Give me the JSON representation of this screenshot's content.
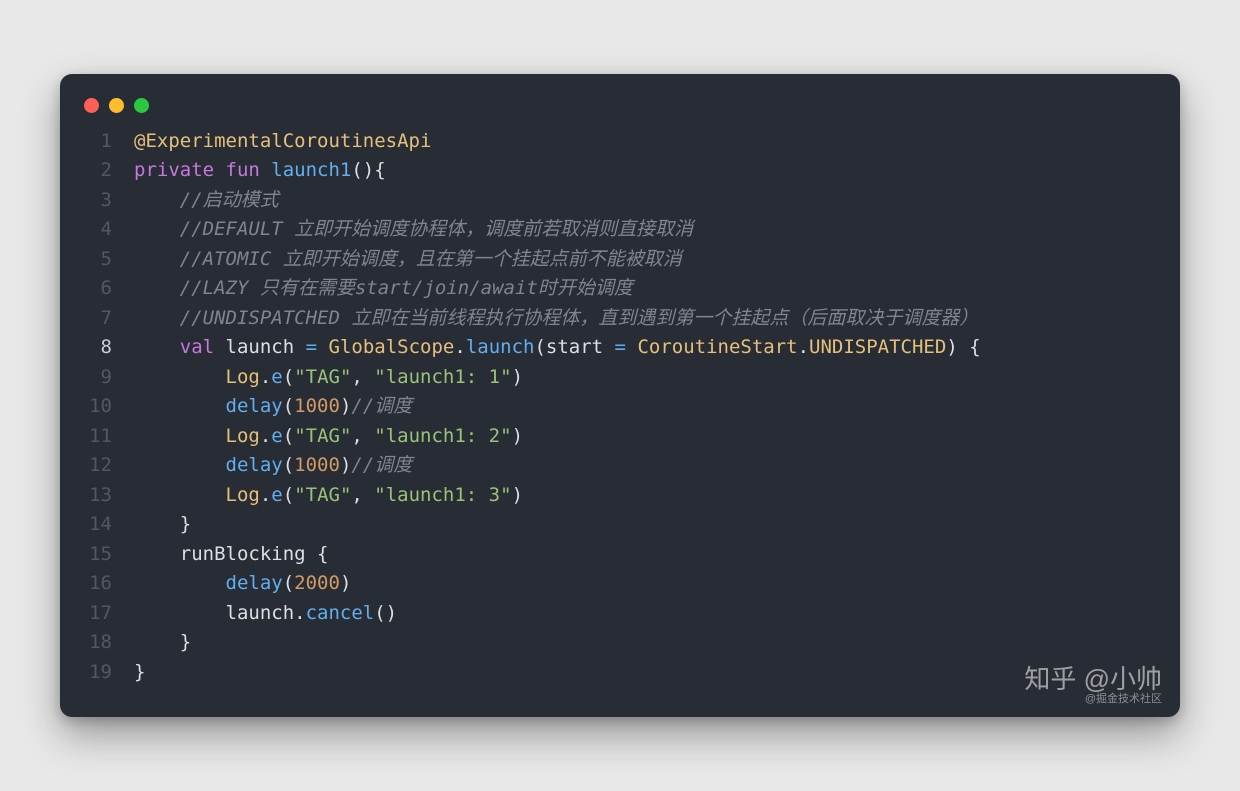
{
  "window": {
    "dots": [
      "close",
      "minimize",
      "maximize"
    ]
  },
  "code": {
    "language": "kotlin",
    "highlighted_line": 8,
    "lines": [
      {
        "n": 1,
        "tokens": [
          [
            "i",
            "@ExperimentalCoroutinesApi"
          ]
        ]
      },
      {
        "n": 2,
        "tokens": [
          [
            "k",
            "private fun "
          ],
          [
            "f",
            "launch1"
          ],
          [
            "w",
            "(){"
          ]
        ]
      },
      {
        "n": 3,
        "tokens": [
          [
            "w",
            "    "
          ],
          [
            "c",
            "//启动模式"
          ]
        ]
      },
      {
        "n": 4,
        "tokens": [
          [
            "w",
            "    "
          ],
          [
            "c",
            "//DEFAULT 立即开始调度协程体，调度前若取消则直接取消"
          ]
        ]
      },
      {
        "n": 5,
        "tokens": [
          [
            "w",
            "    "
          ],
          [
            "c",
            "//ATOMIC 立即开始调度，且在第一个挂起点前不能被取消"
          ]
        ]
      },
      {
        "n": 6,
        "tokens": [
          [
            "w",
            "    "
          ],
          [
            "c",
            "//LAZY 只有在需要start/join/await时开始调度"
          ]
        ]
      },
      {
        "n": 7,
        "tokens": [
          [
            "w",
            "    "
          ],
          [
            "c",
            "//UNDISPATCHED 立即在当前线程执行协程体，直到遇到第一个挂起点（后面取决于调度器）"
          ]
        ]
      },
      {
        "n": 8,
        "tokens": [
          [
            "w",
            "    "
          ],
          [
            "k",
            "val"
          ],
          [
            "w",
            " launch "
          ],
          [
            "f",
            "="
          ],
          [
            "w",
            " "
          ],
          [
            "i",
            "GlobalScope"
          ],
          [
            "w",
            "."
          ],
          [
            "f",
            "launch"
          ],
          [
            "w",
            "(start "
          ],
          [
            "f",
            "="
          ],
          [
            "w",
            " "
          ],
          [
            "i",
            "CoroutineStart"
          ],
          [
            "w",
            "."
          ],
          [
            "i",
            "UNDISPATCHED"
          ],
          [
            "w",
            ") {"
          ]
        ]
      },
      {
        "n": 9,
        "tokens": [
          [
            "w",
            "        "
          ],
          [
            "i",
            "Log"
          ],
          [
            "w",
            "."
          ],
          [
            "f",
            "e"
          ],
          [
            "w",
            "("
          ],
          [
            "s",
            "\"TAG\""
          ],
          [
            "w",
            ", "
          ],
          [
            "s",
            "\"launch1: 1\""
          ],
          [
            "w",
            ")"
          ]
        ]
      },
      {
        "n": 10,
        "tokens": [
          [
            "w",
            "        "
          ],
          [
            "f",
            "delay"
          ],
          [
            "w",
            "("
          ],
          [
            "n",
            "1000"
          ],
          [
            "w",
            ")"
          ],
          [
            "c",
            "//调度"
          ]
        ]
      },
      {
        "n": 11,
        "tokens": [
          [
            "w",
            "        "
          ],
          [
            "i",
            "Log"
          ],
          [
            "w",
            "."
          ],
          [
            "f",
            "e"
          ],
          [
            "w",
            "("
          ],
          [
            "s",
            "\"TAG\""
          ],
          [
            "w",
            ", "
          ],
          [
            "s",
            "\"launch1: 2\""
          ],
          [
            "w",
            ")"
          ]
        ]
      },
      {
        "n": 12,
        "tokens": [
          [
            "w",
            "        "
          ],
          [
            "f",
            "delay"
          ],
          [
            "w",
            "("
          ],
          [
            "n",
            "1000"
          ],
          [
            "w",
            ")"
          ],
          [
            "c",
            "//调度"
          ]
        ]
      },
      {
        "n": 13,
        "tokens": [
          [
            "w",
            "        "
          ],
          [
            "i",
            "Log"
          ],
          [
            "w",
            "."
          ],
          [
            "f",
            "e"
          ],
          [
            "w",
            "("
          ],
          [
            "s",
            "\"TAG\""
          ],
          [
            "w",
            ", "
          ],
          [
            "s",
            "\"launch1: 3\""
          ],
          [
            "w",
            ")"
          ]
        ]
      },
      {
        "n": 14,
        "tokens": [
          [
            "w",
            "    }"
          ]
        ]
      },
      {
        "n": 15,
        "tokens": [
          [
            "w",
            "    runBlocking {"
          ]
        ]
      },
      {
        "n": 16,
        "tokens": [
          [
            "w",
            "        "
          ],
          [
            "f",
            "delay"
          ],
          [
            "w",
            "("
          ],
          [
            "n",
            "2000"
          ],
          [
            "w",
            ")"
          ]
        ]
      },
      {
        "n": 17,
        "tokens": [
          [
            "w",
            "        launch."
          ],
          [
            "f",
            "cancel"
          ],
          [
            "w",
            "()"
          ]
        ]
      },
      {
        "n": 18,
        "tokens": [
          [
            "w",
            "    }"
          ]
        ]
      },
      {
        "n": 19,
        "tokens": [
          [
            "w",
            "}"
          ]
        ]
      }
    ]
  },
  "watermark": {
    "main": "知乎 @小帅",
    "sub": "@掘金技术社区"
  }
}
